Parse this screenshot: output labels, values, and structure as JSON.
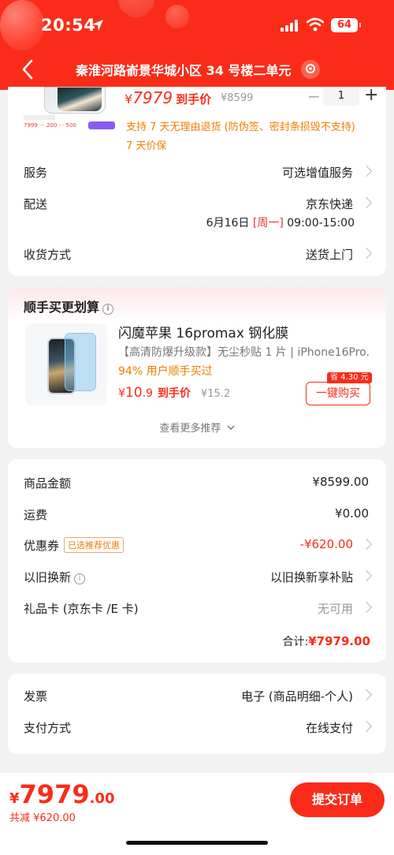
{
  "status": {
    "time": "20:54",
    "battery": "64"
  },
  "nav": {
    "address": "秦淮河路嵛景华城小区 34 号楼二单元"
  },
  "product": {
    "price_currency": "¥",
    "price": "7979",
    "price_label": "到手价",
    "original_price": "¥8599",
    "quantity": "1",
    "minus": "−",
    "plus": "+",
    "notice1": "支持 7 天无理由退货 (防伪签、密封条损毁不支持)",
    "notice2": "7 天价保"
  },
  "service": {
    "label": "服务",
    "value": "可选增值服务"
  },
  "delivery": {
    "label": "配送",
    "value": "京东快递",
    "date": "6月16日",
    "weekday": "[周一]",
    "slot": "09:00-15:00"
  },
  "receive": {
    "label": "收货方式",
    "value": "送货上门"
  },
  "recommend": {
    "title": "顺手买更划算",
    "info": "i",
    "name": "闪魔苹果 16promax 钢化膜",
    "subtitle": "【高清防爆升级款】无尘秒贴 1 片  |  iPhone16Pro...",
    "buyers": "94% 用户顺手买过",
    "price_currency": "¥",
    "price_int": "10",
    "price_dec": ".9",
    "price_label": "到手价",
    "original_price": "¥15.2",
    "save_tag": "省 4.30 元",
    "buy_button": "一键购买",
    "more": "查看更多推荐"
  },
  "price_detail": {
    "goods_label": "商品金额",
    "goods_value": "¥8599.00",
    "shipping_label": "运费",
    "shipping_value": "¥0.00",
    "coupon_label": "优惠券",
    "coupon_tag": "已选推荐优惠",
    "coupon_value": "-¥620.00",
    "tradein_label": "以旧换新",
    "tradein_info": "i",
    "tradein_value": "以旧换新享补贴",
    "giftcard_label": "礼品卡 (京东卡 /E 卡)",
    "giftcard_value": "无可用",
    "total_label": "合计:",
    "total_value": "¥7979.00"
  },
  "invoice": {
    "label": "发票",
    "value": "电子 (商品明细-个人)"
  },
  "payment": {
    "label": "支付方式",
    "value": "在线支付"
  },
  "bottom": {
    "currency": "¥",
    "price_int": "7979",
    "price_dec": ".00",
    "saved": "共减 ¥620.00",
    "submit": "提交订单"
  },
  "colors": {
    "brand_red": "#fa2c19",
    "orange": "#f07e00"
  }
}
